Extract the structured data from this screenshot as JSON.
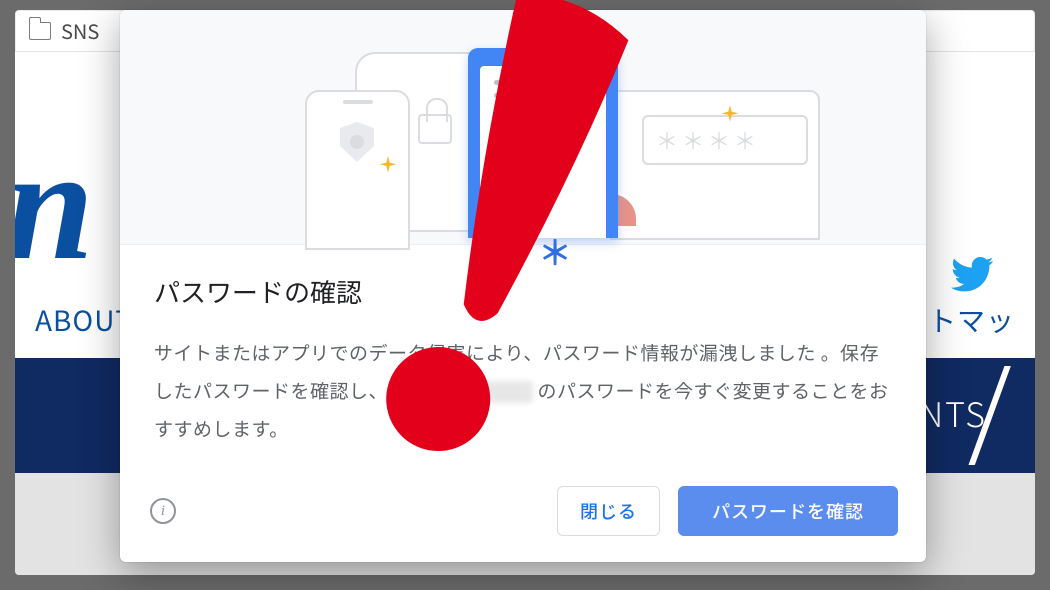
{
  "bookmark_bar": {
    "folder_label": "SNS"
  },
  "background_page": {
    "nav_left_fragment": "ABOUT",
    "nav_right_fragment": "イトマッ",
    "banner_right_fragment": "ENTS"
  },
  "modal": {
    "title": "パスワードの確認",
    "message_part1": "サイトまたはアプリでのデータ侵害により、パスワード情報が漏洩しました 。保存したパスワードを確認し、",
    "message_part2": " のパスワードを今すぐ変更することをおすすめします。",
    "buttons": {
      "close": "閉じる",
      "confirm": "パスワードを確認"
    },
    "illustration": {
      "stars_field_text": "＊＊＊＊"
    }
  }
}
